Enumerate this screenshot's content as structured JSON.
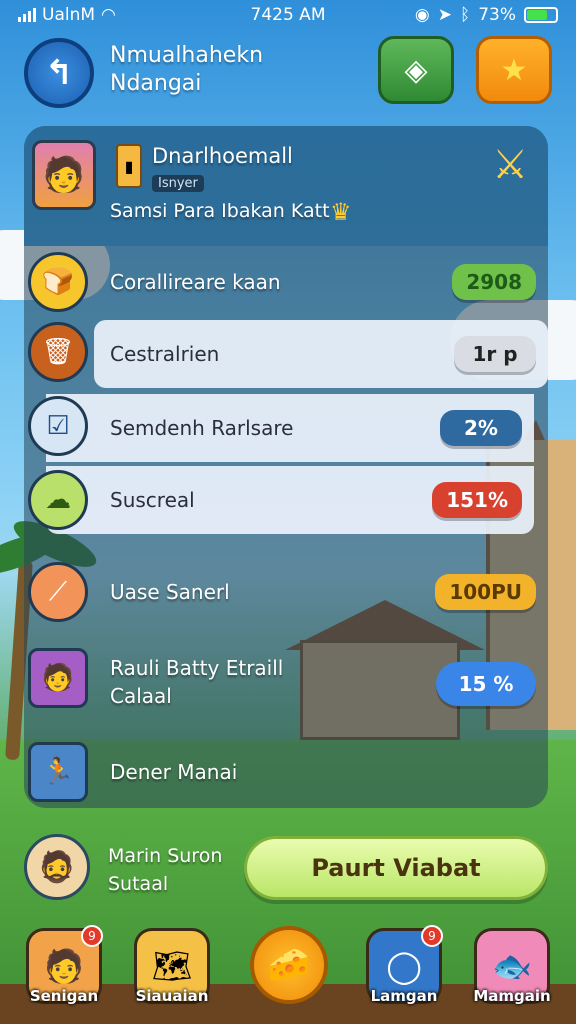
{
  "status_bar": {
    "carrier": "UalnM",
    "time": "7425 AM",
    "battery": "73%"
  },
  "header": {
    "title_line1": "Nmualhahekn",
    "title_line2": "Ndangai",
    "icons": {
      "back": "back-arrow-icon",
      "map": "map-pin-icon",
      "star": "star-icon"
    }
  },
  "profile": {
    "name": "Dnarlhoemall",
    "tag": "Isnyer",
    "subtitle": "Samsi Para Ibakan Katt"
  },
  "list": [
    {
      "label": "Corallireare kaan",
      "value": "2908",
      "pill_color": "#6fc14a",
      "icon": "bread-icon",
      "icon_bg": "#f7c52c",
      "style": "dark"
    },
    {
      "label": "Cestralrien",
      "value": "1r p",
      "pill_color": "#d9dde3",
      "icon": "trash-icon",
      "icon_bg": "#c9611e",
      "style": "light"
    },
    {
      "label": "Semdenh Rarlsare",
      "value": "2%",
      "pill_color": "#2e6aa0",
      "icon": "clipboard-check-icon",
      "icon_bg": "#d7e6f5",
      "style": "light"
    },
    {
      "label": "Suscreal",
      "value": "151%",
      "pill_color": "#d9412f",
      "icon": "cloud-icon",
      "icon_bg": "#b9e06a",
      "style": "light"
    },
    {
      "label": "Uase Sanerl",
      "value": "100PU",
      "pill_color": "#f2b22a",
      "icon": "slide-icon",
      "icon_bg": "#f2935a",
      "style": "dark"
    },
    {
      "label": "Rauli Batty Etraill",
      "label2": "Calaal",
      "value": "15 %",
      "pill_color": "#3a86e8",
      "icon": "person-avatar-icon",
      "icon_bg": "#a45ec5",
      "style": "dark"
    },
    {
      "label": "Dener Manai",
      "value": "",
      "icon": "figure-icon",
      "icon_bg": "#4a86c8",
      "style": "dark"
    }
  ],
  "footer": {
    "name_line1": "Marin Suron",
    "name_line2": "Sutaal",
    "cta": "Paurt Viabat"
  },
  "nav": [
    {
      "label": "Senigan",
      "icon": "person-icon",
      "badge": "9",
      "bg": "#f2a34a"
    },
    {
      "label": "Siauaian",
      "icon": "map-icon",
      "badge": "",
      "bg": "#f5c046"
    },
    {
      "label": "",
      "icon": "cheese-icon",
      "badge": "",
      "bg": "#f8a41e"
    },
    {
      "label": "Lamgan",
      "icon": "ring-icon",
      "badge": "9",
      "bg": "#3277c9"
    },
    {
      "label": "Mamgain",
      "icon": "fish-icon",
      "badge": "",
      "bg": "#f08ab8"
    }
  ]
}
